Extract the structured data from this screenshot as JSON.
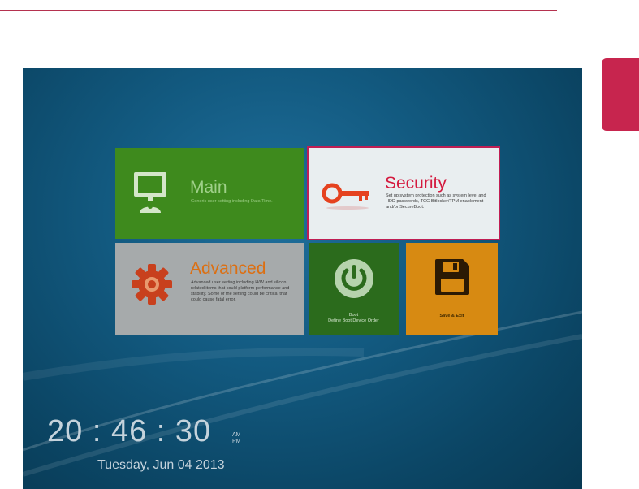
{
  "colors": {
    "accent": "#c7254e",
    "main_tile": "#3e8a1d",
    "security_tile": "#e9eef0",
    "advanced_tile": "#a6aaab",
    "boot_tile": "#2b6b1c",
    "save_tile": "#d78a12",
    "screen_bg": "#12597f"
  },
  "tiles": {
    "main": {
      "title": "Main",
      "description": "Generic user setting including Date/Time.",
      "icon": "monitor-icon"
    },
    "security": {
      "title": "Security",
      "description": "Set up system protection such as system level and HDD passwords, TCG Bitlocker/TPM enablement and/or SecureBoot.",
      "icon": "key-icon"
    },
    "advanced": {
      "title": "Advanced",
      "description": "Advanced user setting including H/W and silicon related items that could platform performance and stability. Some of the setting could be critical that could cause fatal error.",
      "icon": "gear-icon"
    },
    "boot": {
      "title": "Boot",
      "description": "Define Boot Device Order",
      "icon": "power-icon"
    },
    "save_exit": {
      "title": "Save & Exit",
      "icon": "floppy-disk-icon"
    }
  },
  "clock": {
    "time": "20 : 46 : 30",
    "am": "AM",
    "pm": "PM",
    "date": "Tuesday, Jun 04 2013"
  }
}
